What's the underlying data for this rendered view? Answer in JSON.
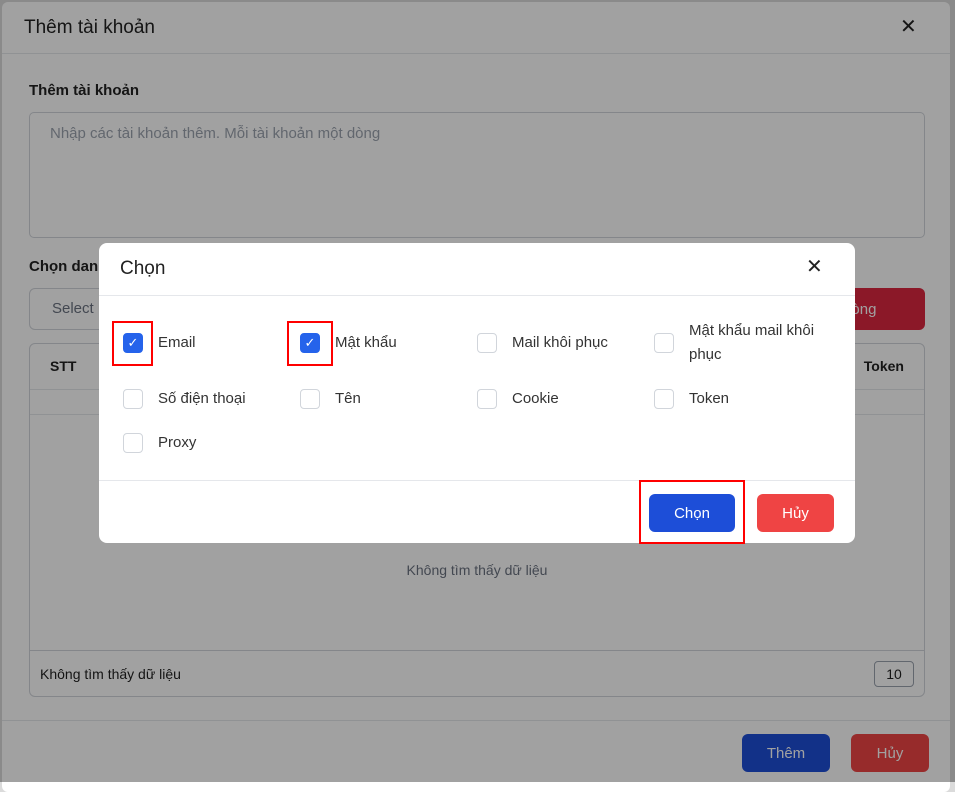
{
  "dialog": {
    "title": "Thêm tài khoản",
    "section_label": "Thêm tài khoản",
    "textarea_placeholder": "Nhập các tài khoản thêm. Mỗi tài khoản một dòng",
    "select_label": "Chọn dan",
    "select_placeholder": "Select",
    "delete_rows_label": "a dòng",
    "table": {
      "headers": [
        "STT",
        "Token"
      ],
      "empty_text": "Không tìm thấy dữ liệu",
      "footer_text": "Không tìm thấy dữ liệu",
      "page_size": "10"
    },
    "add_label": "Thêm",
    "cancel_label": "Hủy"
  },
  "modal": {
    "title": "Chọn",
    "options": [
      {
        "label": "Email",
        "checked": true
      },
      {
        "label": "Mật khẩu",
        "checked": true
      },
      {
        "label": "Mail khôi phục",
        "checked": false
      },
      {
        "label": "Mật khẩu mail khôi phục",
        "checked": false
      },
      {
        "label": "Số điện thoại",
        "checked": false
      },
      {
        "label": "Tên",
        "checked": false
      },
      {
        "label": "Cookie",
        "checked": false
      },
      {
        "label": "Token",
        "checked": false
      },
      {
        "label": "Proxy",
        "checked": false
      }
    ],
    "confirm_label": "Chọn",
    "cancel_label": "Hủy"
  },
  "colors": {
    "primary": "#1d4ed8",
    "danger": "#ef4444",
    "highlight": "#ff0000"
  }
}
